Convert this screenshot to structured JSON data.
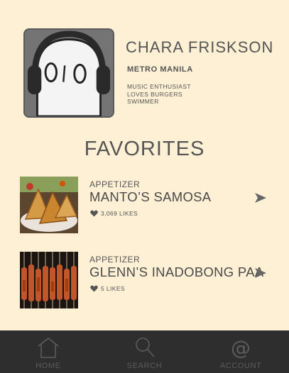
{
  "profile": {
    "name": "CHARA FRISKSON",
    "location": "METRO MANILA",
    "tags": [
      "MUSIC ENTHUSIAST",
      "LOVES BURGERS",
      "SWIMMER"
    ]
  },
  "favorites": {
    "title": "FAVORITES",
    "items": [
      {
        "category": "APPETIZER",
        "name": "MANTO’S SAMOSA",
        "likes": "3,069 LIKES"
      },
      {
        "category": "APPETIZER",
        "name": "GLENN’S INADOBONG PAA",
        "likes": "5 LIKES"
      }
    ]
  },
  "nav": {
    "items": [
      {
        "label": "HOME",
        "icon": "home-icon"
      },
      {
        "label": "SEARCH",
        "icon": "search-icon"
      },
      {
        "label": "ACCOUNT",
        "icon": "at-icon"
      }
    ]
  },
  "colors": {
    "background": "#fdf0d5",
    "text": "#555555",
    "nav_background": "#2e2e2e",
    "nav_text": "#5c5c5c"
  }
}
